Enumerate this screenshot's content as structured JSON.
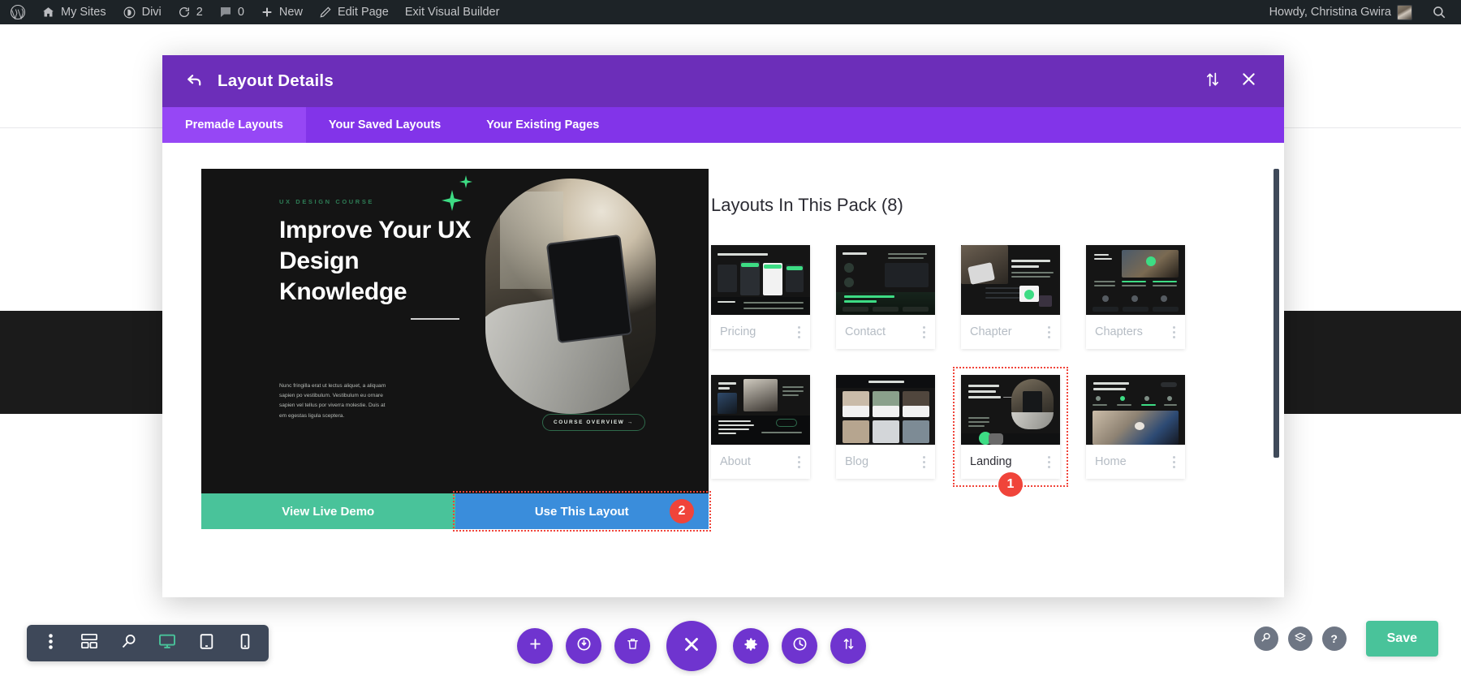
{
  "adminbar": {
    "left_items": [
      {
        "icon": "wordpress-logo-icon",
        "label": ""
      },
      {
        "icon": "my-sites-icon",
        "label": "My Sites"
      },
      {
        "icon": "divi-icon",
        "label": "Divi"
      },
      {
        "icon": "updates-icon",
        "label": "2"
      },
      {
        "icon": "comments-icon",
        "label": "0"
      },
      {
        "icon": "plus-icon",
        "label": "New"
      },
      {
        "icon": "pencil-icon",
        "label": "Edit Page"
      },
      {
        "icon": "",
        "label": "Exit Visual Builder"
      }
    ],
    "howdy": "Howdy, Christina Gwira",
    "search_icon": "search-icon"
  },
  "modal": {
    "title": "Layout Details",
    "back_icon": "back-arrow-icon",
    "sort_icon": "sort-updown-icon",
    "close_icon": "close-icon",
    "tabs": [
      {
        "label": "Premade Layouts",
        "active": true
      },
      {
        "label": "Your Saved Layouts",
        "active": false
      },
      {
        "label": "Your Existing Pages",
        "active": false
      }
    ]
  },
  "preview": {
    "eyebrow": "UX DESIGN COURSE",
    "heading": "Improve Your UX Design Knowledge",
    "body": "Nunc fringilla erat ut lectus aliquet, a aliquam sapien po vestibulum. Vestibulum eu ornare sapien vel tellus por viverra molestie. Duis at em egestas ligula sceptera.",
    "cta": "COURSE OVERVIEW →",
    "demo_button": "View Live Demo",
    "use_button": "Use This Layout"
  },
  "annotations": [
    {
      "id": "badge-use-this-layout",
      "number": "2"
    },
    {
      "id": "badge-landing-card",
      "number": "1"
    }
  ],
  "pack": {
    "title": "Layouts In This Pack (8)",
    "cards": [
      {
        "label": "Pricing",
        "selected": false,
        "thumb": "pricing-thumbnail"
      },
      {
        "label": "Contact",
        "selected": false,
        "thumb": "contact-thumbnail"
      },
      {
        "label": "Chapter",
        "selected": false,
        "thumb": "chapter-thumbnail"
      },
      {
        "label": "Chapters",
        "selected": false,
        "thumb": "chapters-thumbnail"
      },
      {
        "label": "About",
        "selected": false,
        "thumb": "about-thumbnail"
      },
      {
        "label": "Blog",
        "selected": false,
        "thumb": "blog-thumbnail"
      },
      {
        "label": "Landing",
        "selected": true,
        "thumb": "landing-thumbnail"
      },
      {
        "label": "Home",
        "selected": false,
        "thumb": "home-thumbnail"
      }
    ],
    "menu_icon": "three-dots-vertical-icon"
  },
  "toolbar_left": [
    {
      "icon": "three-dots-vertical-icon",
      "active": false
    },
    {
      "icon": "wireframe-view-icon",
      "active": false
    },
    {
      "icon": "zoom-view-icon",
      "active": false
    },
    {
      "icon": "desktop-view-icon",
      "active": true
    },
    {
      "icon": "tablet-view-icon",
      "active": false
    },
    {
      "icon": "phone-view-icon",
      "active": false
    }
  ],
  "toolbar_center": [
    {
      "icon": "add-section-icon",
      "big": false
    },
    {
      "icon": "load-layout-icon",
      "big": false
    },
    {
      "icon": "trash-icon",
      "big": false
    },
    {
      "icon": "close-builder-icon",
      "big": true
    },
    {
      "icon": "settings-gear-icon",
      "big": false
    },
    {
      "icon": "history-clock-icon",
      "big": false
    },
    {
      "icon": "portability-updown-icon",
      "big": false
    }
  ],
  "toolbar_right": {
    "icons": [
      {
        "icon": "search-icon"
      },
      {
        "icon": "layers-icon"
      },
      {
        "icon": "help-icon"
      }
    ],
    "save_label": "Save"
  },
  "colors": {
    "adminbar_bg": "#1d2327",
    "modal_header": "#6c2eb9",
    "modal_tabs": "#8234e9",
    "tab_active": "#9647f5",
    "demo_green": "#49c39a",
    "use_blue": "#3a8ddb",
    "annotation_red": "#f0443a",
    "builder_purple": "#6f34cf",
    "toolbar_slate": "#3e4859"
  }
}
